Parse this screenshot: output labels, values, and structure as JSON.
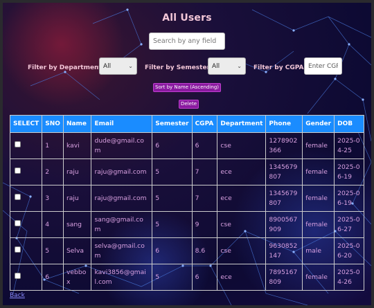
{
  "page": {
    "title": "All Users",
    "search_placeholder": "Search by any field"
  },
  "filters": {
    "department_label": "Filter by Department:",
    "department_value": "All",
    "semester_label": "Filter by Semester:",
    "semester_value": "All",
    "cgpa_label": "Filter by CGPA:",
    "cgpa_placeholder": "Enter CGPA"
  },
  "actions": {
    "sort_label": "Sort by Name (Ascending)",
    "delete_label": "Delete",
    "back_label": "Back"
  },
  "table": {
    "headers": [
      "SELECT",
      "SNO",
      "Name",
      "Email",
      "Semester",
      "CGPA",
      "Department",
      "Phone",
      "Gender",
      "DOB"
    ],
    "rows": [
      [
        "",
        "1",
        "kavi",
        "dude@gmail.com",
        "6",
        "6",
        "cse",
        "1278902366",
        "female",
        "2025-04-25"
      ],
      [
        "",
        "2",
        "raju",
        "raju@gmail.com",
        "5",
        "7",
        "ece",
        "1345679807",
        "female",
        "2025-06-19"
      ],
      [
        "",
        "3",
        "raju",
        "raju@gmail.com",
        "5",
        "7",
        "ece",
        "1345679807",
        "female",
        "2025-06-19"
      ],
      [
        "",
        "4",
        "sang",
        "sang@gmail.com",
        "5",
        "9",
        "cse",
        "8900567909",
        "female",
        "2025-06-27"
      ],
      [
        "",
        "5",
        "Selva",
        "selva@gmail.com",
        "6",
        "8.6",
        "cse",
        "9630852147",
        "male",
        "2025-06-20"
      ],
      [
        "",
        "6",
        "vebbox",
        "kavi3856@gmail.com",
        "5",
        "6",
        "ece",
        "7895167809",
        "female",
        "2025-04-26"
      ]
    ]
  },
  "colors": {
    "header_bg": "#1a8cff",
    "cell_text": "#d8a0e0",
    "title_text": "#f3c7d8",
    "button_bg": "#8a1aa0"
  }
}
